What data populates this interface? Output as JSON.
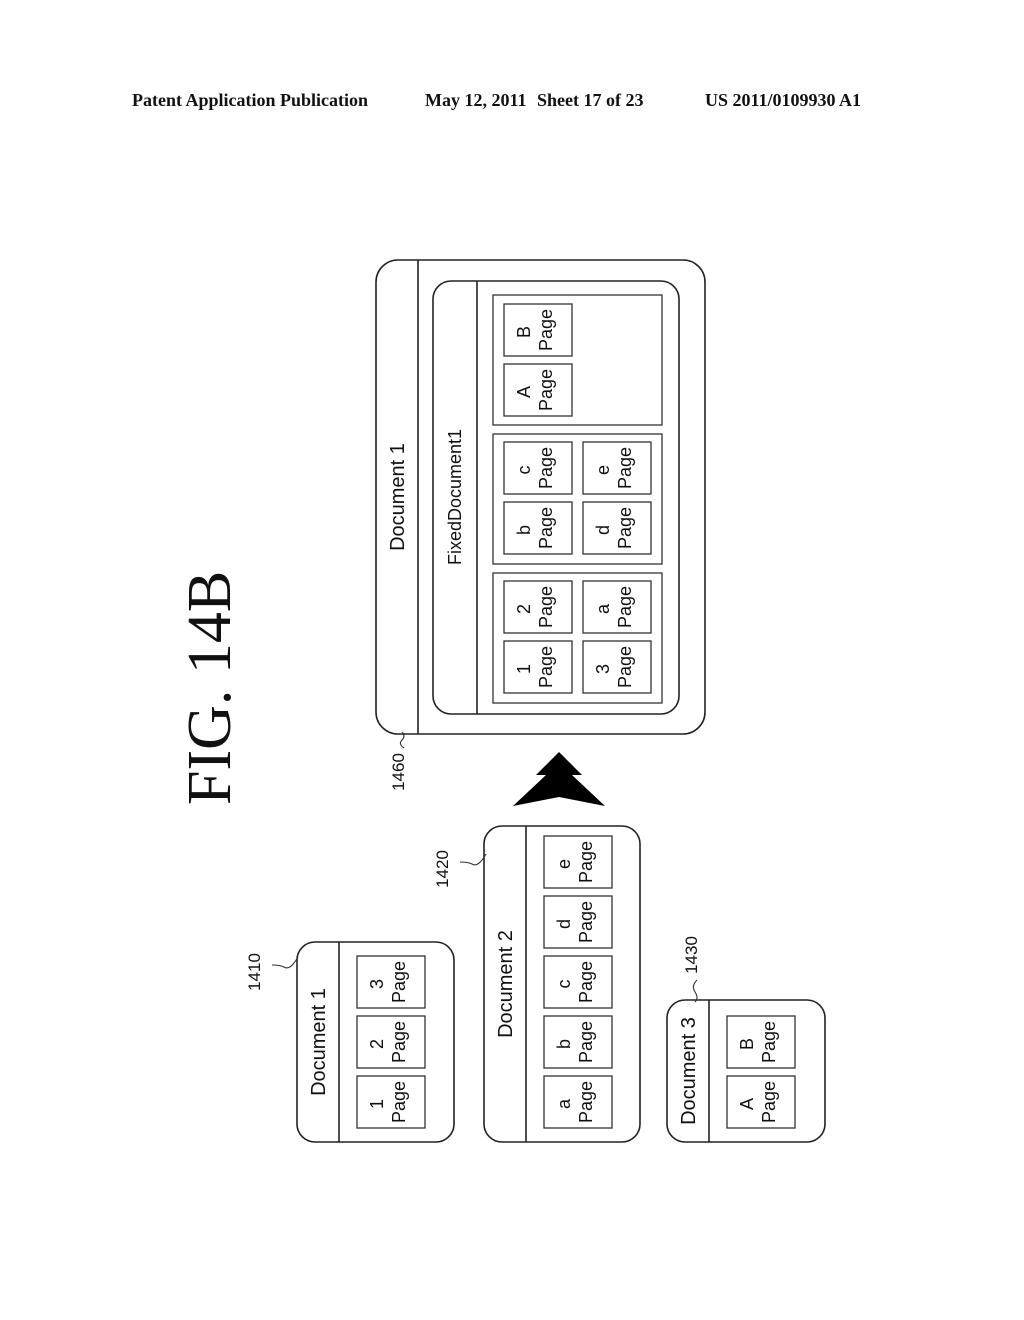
{
  "header": {
    "publication": "Patent Application Publication",
    "date": "May 12, 2011",
    "sheet": "Sheet 17 of 23",
    "publication_number": "US 2011/0109930 A1"
  },
  "figure": {
    "title": "FIG. 14B",
    "orientation": "rotated 90 degrees counter-clockwise",
    "arrow_icon": "merge-arrow-icon",
    "page_word": "Page",
    "source_documents": [
      {
        "ref": "1410",
        "title": "Document 1",
        "pages": [
          "1",
          "2",
          "3"
        ]
      },
      {
        "ref": "1420",
        "title": "Document 2",
        "pages": [
          "a",
          "b",
          "c",
          "d",
          "e"
        ]
      },
      {
        "ref": "1430",
        "title": "Document 3",
        "pages": [
          "A",
          "B"
        ]
      }
    ],
    "result": {
      "ref": "1460",
      "title": "Document 1",
      "fixed_document": "FixedDocument1",
      "groups": [
        {
          "pages": [
            "1",
            "2",
            "3",
            "a"
          ]
        },
        {
          "pages": [
            "b",
            "c",
            "d",
            "e"
          ]
        },
        {
          "pages": [
            "A",
            "B"
          ]
        }
      ]
    }
  }
}
